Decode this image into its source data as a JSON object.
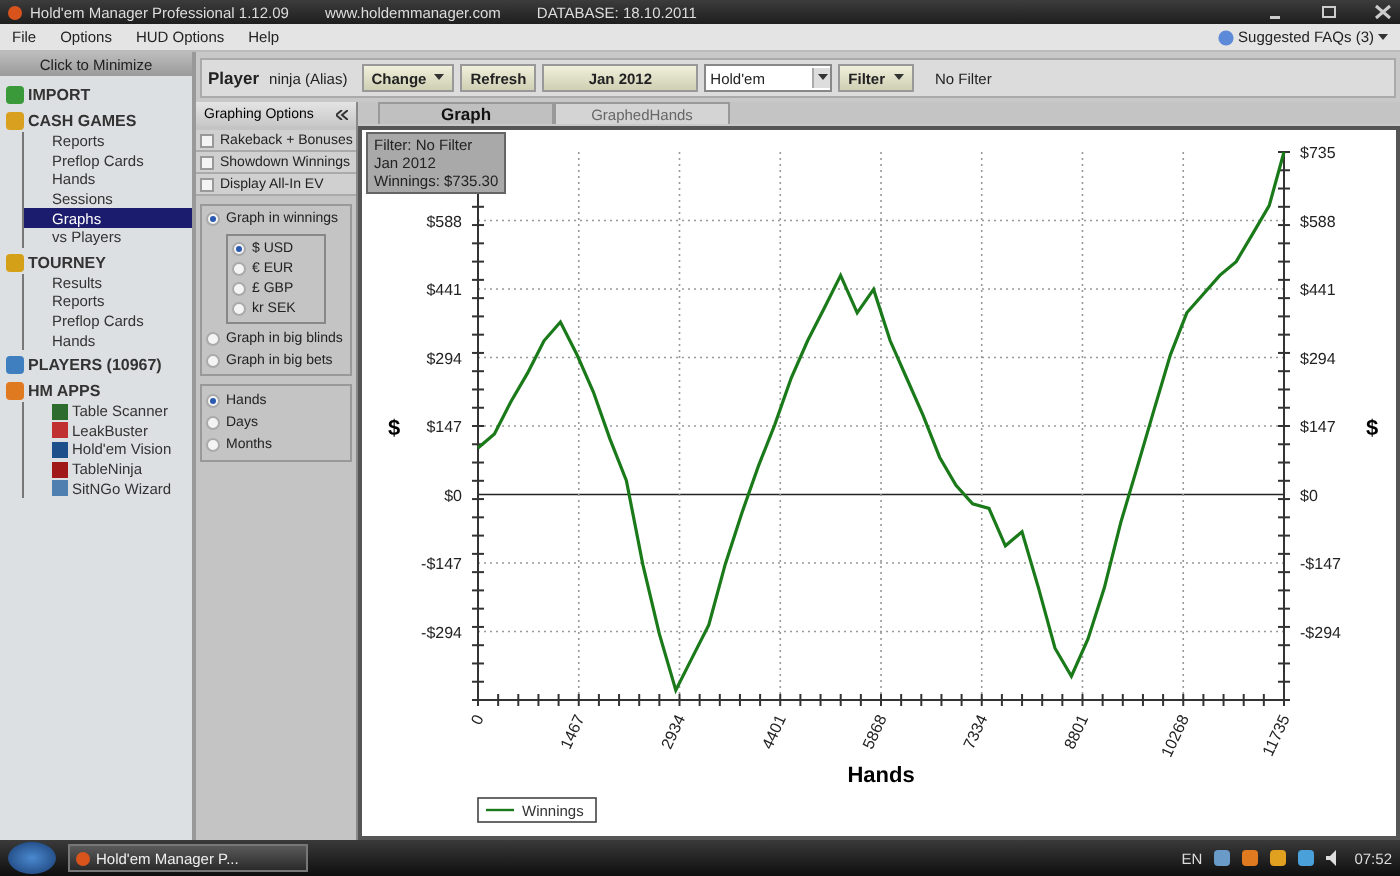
{
  "window": {
    "title": "Hold'em Manager Professional 1.12.09",
    "url": "www.holdemmanager.com",
    "database": "DATABASE: 18.10.2011"
  },
  "menu": [
    "File",
    "Options",
    "HUD Options",
    "Help"
  ],
  "faq": "Suggested FAQs (3)",
  "sidebar": {
    "minimize": "Click to Minimize",
    "sections": [
      {
        "label": "IMPORT",
        "kind": "import"
      },
      {
        "label": "CASH GAMES",
        "kind": "cash",
        "children": [
          {
            "label": "Reports",
            "selected": false
          },
          {
            "label": "Preflop Cards",
            "selected": false
          },
          {
            "label": "Hands",
            "selected": false
          },
          {
            "label": "Sessions",
            "selected": false
          },
          {
            "label": "Graphs",
            "selected": true
          },
          {
            "label": "vs Players",
            "selected": false
          }
        ]
      },
      {
        "label": "TOURNEY",
        "kind": "tourney",
        "children": [
          {
            "label": "Results",
            "selected": false
          },
          {
            "label": "Reports",
            "selected": false
          },
          {
            "label": "Preflop Cards",
            "selected": false
          },
          {
            "label": "Hands",
            "selected": false
          }
        ]
      },
      {
        "label": "PLAYERS (10967)",
        "kind": "players"
      },
      {
        "label": "HM APPS",
        "kind": "apps",
        "children": [
          {
            "label": "Table Scanner",
            "selected": false,
            "color": "#2e6b2e"
          },
          {
            "label": "LeakBuster",
            "selected": false,
            "color": "#c03030"
          },
          {
            "label": "Hold'em Vision",
            "selected": false,
            "color": "#1d4f8a"
          },
          {
            "label": "TableNinja",
            "selected": false,
            "color": "#a01818"
          },
          {
            "label": "SitNGo Wizard",
            "selected": false,
            "color": "#4f7fb0"
          }
        ]
      }
    ]
  },
  "toolbar": {
    "player_label": "Player",
    "player": "ninja (Alias)",
    "change": "Change",
    "refresh": "Refresh",
    "date": "Jan 2012",
    "game": "Hold'em",
    "filter": "Filter",
    "filter_text": "No Filter"
  },
  "options": {
    "title": "Graphing Options",
    "checkboxes": [
      {
        "label": "Rakeback + Bonuses",
        "checked": false
      },
      {
        "label": "Showdown Winnings",
        "checked": false
      },
      {
        "label": "Display All-In EV",
        "checked": false
      }
    ],
    "winnings": {
      "label": "Graph in winnings",
      "selected": true
    },
    "currencies": [
      {
        "label": "$ USD",
        "selected": true
      },
      {
        "label": "€ EUR",
        "selected": false
      },
      {
        "label": "£ GBP",
        "selected": false
      },
      {
        "label": "kr SEK",
        "selected": false
      }
    ],
    "units": [
      {
        "label": "Graph in big blinds",
        "selected": false
      },
      {
        "label": "Graph in big bets",
        "selected": false
      }
    ],
    "periods": [
      {
        "label": "Hands",
        "selected": true
      },
      {
        "label": "Days",
        "selected": false
      },
      {
        "label": "Months",
        "selected": false
      }
    ]
  },
  "tabs": [
    {
      "label": "Graph",
      "selected": true
    },
    {
      "label": "GraphedHands",
      "selected": false
    }
  ],
  "chart": {
    "tooltip": [
      "Filter: No Filter",
      "Jan 2012",
      "Winnings: $735.30"
    ],
    "left_axis_label": "$",
    "right_axis_label": "$",
    "right_yticks": [
      "$735",
      "$588",
      "$441",
      "$294",
      "$147",
      "$0",
      "-$147",
      "-$294"
    ],
    "chart_data": {
      "type": "line",
      "grid": true,
      "xlabel": "Hands",
      "xlim": [
        0,
        11735
      ],
      "ylim": [
        -441,
        735
      ],
      "xticks": [
        0,
        1467,
        2934,
        4401,
        5868,
        7334,
        8801,
        10268,
        11735
      ],
      "yticks": [
        {
          "value": -294,
          "label": "-$294"
        },
        {
          "value": -147,
          "label": "-$147"
        },
        {
          "value": 0,
          "label": "$0"
        },
        {
          "value": 147,
          "label": "$147"
        },
        {
          "value": 294,
          "label": "$294"
        },
        {
          "value": 441,
          "label": "$441"
        },
        {
          "value": 588,
          "label": "$588"
        }
      ],
      "x": [
        0,
        240,
        480,
        720,
        960,
        1200,
        1440,
        1680,
        1920,
        2160,
        2400,
        2640,
        2880,
        3120,
        3360,
        3600,
        3840,
        4080,
        4320,
        4560,
        4800,
        5040,
        5280,
        5520,
        5760,
        6000,
        6240,
        6480,
        6720,
        6960,
        7200,
        7440,
        7680,
        7920,
        8160,
        8400,
        8640,
        8880,
        9120,
        9360,
        9600,
        9840,
        10080,
        10320,
        10560,
        10800,
        11040,
        11280,
        11520,
        11735
      ],
      "series": [
        {
          "name": "Winnings",
          "color": "#1a7a1a",
          "values": [
            100,
            130,
            200,
            260,
            330,
            370,
            300,
            220,
            120,
            30,
            -150,
            -300,
            -420,
            -350,
            -280,
            -150,
            -40,
            60,
            150,
            250,
            330,
            400,
            470,
            390,
            440,
            330,
            250,
            170,
            80,
            20,
            -20,
            -30,
            -110,
            -80,
            -200,
            -330,
            -390,
            -310,
            -200,
            -60,
            60,
            180,
            300,
            390,
            430,
            470,
            500,
            560,
            620,
            735
          ]
        }
      ]
    }
  },
  "taskbar": {
    "task": "Hold'em Manager P...",
    "lang": "EN",
    "time": "07:52"
  }
}
